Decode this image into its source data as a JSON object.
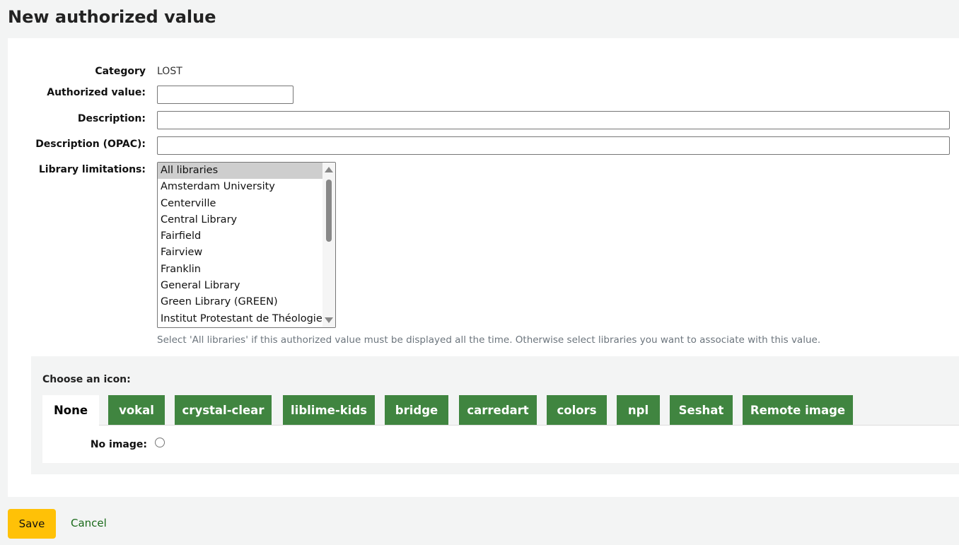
{
  "title": "New authorized value",
  "form": {
    "category_label": "Category",
    "category_value": "LOST",
    "authorized_value_label": "Authorized value:",
    "authorized_value": "",
    "description_label": "Description:",
    "description": "",
    "description_opac_label": "Description (OPAC):",
    "description_opac": "",
    "library_limitations_label": "Library limitations:",
    "libraries": [
      "All libraries",
      "Amsterdam University",
      "Centerville",
      "Central Library",
      "Fairfield",
      "Fairview",
      "Franklin",
      "General Library",
      "Green Library (GREEN)",
      "Institut Protestant de Théologie"
    ],
    "selected_library": "All libraries",
    "help": "Select 'All libraries' if this authorized value must be displayed all the time. Otherwise select libraries you want to associate with this value."
  },
  "icons": {
    "legend": "Choose an icon:",
    "tabs": [
      "None",
      "vokal",
      "crystal-clear",
      "liblime-kids",
      "bridge",
      "carredart",
      "colors",
      "npl",
      "Seshat",
      "Remote image"
    ],
    "active_tab": "None",
    "no_image_label": "No image:"
  },
  "actions": {
    "save": "Save",
    "cancel": "Cancel"
  },
  "colors": {
    "tab": "#408540",
    "save": "#ffc107"
  }
}
